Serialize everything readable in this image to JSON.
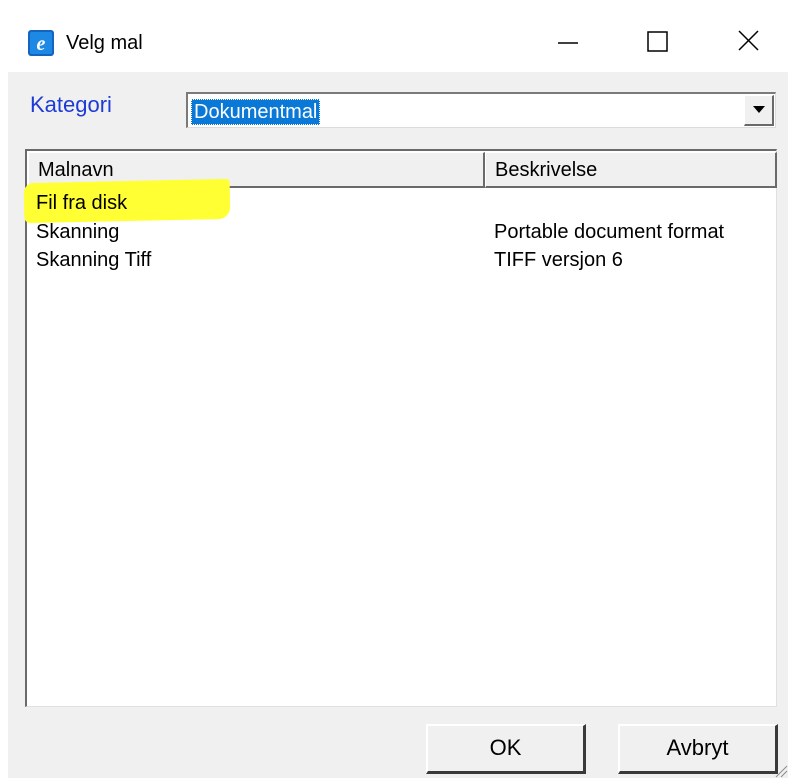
{
  "window": {
    "title": "Velg mal",
    "icon": "app-e-icon",
    "controls": [
      "minimize-icon",
      "maximize-icon",
      "close-icon"
    ]
  },
  "category": {
    "label": "Kategori",
    "selected": "Dokumentmal"
  },
  "list": {
    "columns": [
      "Malnavn",
      "Beskrivelse"
    ],
    "rows": [
      {
        "name": "Fil fra disk",
        "description": ""
      },
      {
        "name": "Skanning",
        "description": "Portable document format"
      },
      {
        "name": "Skanning Tiff",
        "description": "TIFF versjon 6"
      }
    ],
    "highlighted_row": 0,
    "highlight_color": "#ffff33"
  },
  "buttons": {
    "ok": "OK",
    "cancel": "Avbryt"
  },
  "colors": {
    "label_blue": "#1d3bd6",
    "selection_blue": "#0a78d7",
    "dialog_bg": "#f0f0f0"
  }
}
